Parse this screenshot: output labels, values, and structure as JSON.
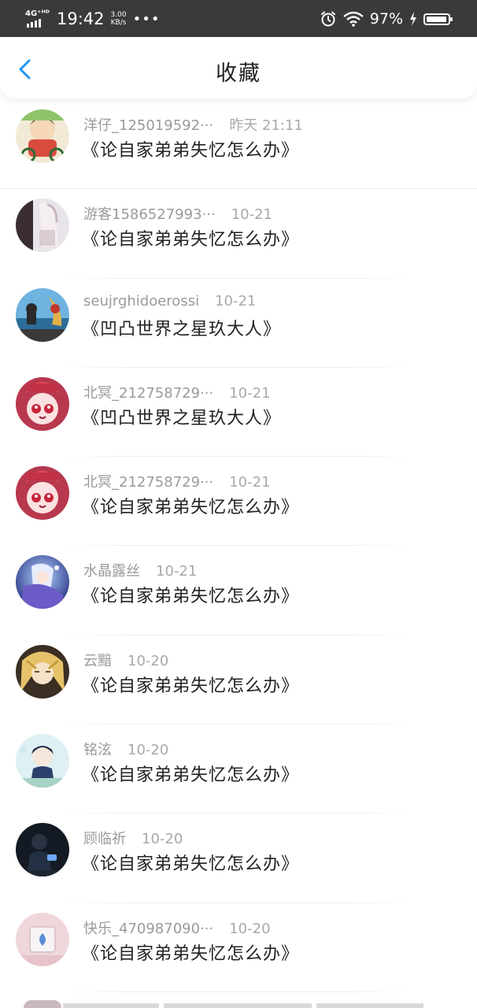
{
  "status_bar": {
    "network": "4G⁺ᴴᴰ",
    "time": "19:42",
    "speed_value": "3.00",
    "speed_unit": "KB/s",
    "more": "•••",
    "battery_percent": "97%",
    "battery_level": 0.97
  },
  "header": {
    "title": "收藏",
    "back_icon": "chevron-left-icon"
  },
  "colors": {
    "accent": "#2196F3",
    "status_bar_bg": "#3a3a3a"
  },
  "items": [
    {
      "user": "洋仔_125019592···",
      "time": "昨天 21:11",
      "book": "《论自家弟弟失忆怎么办》"
    },
    {
      "user": "游客1586527993···",
      "time": "10-21",
      "book": "《论自家弟弟失忆怎么办》"
    },
    {
      "user": "seujrghidoerossi",
      "time": "10-21",
      "book": "《凹凸世界之星玖大人》"
    },
    {
      "user": "北冥_212758729···",
      "time": "10-21",
      "book": "《凹凸世界之星玖大人》"
    },
    {
      "user": "北冥_212758729···",
      "time": "10-21",
      "book": "《论自家弟弟失忆怎么办》"
    },
    {
      "user": "水晶露丝",
      "time": "10-21",
      "book": "《论自家弟弟失忆怎么办》"
    },
    {
      "user": "云黯",
      "time": "10-20",
      "book": "《论自家弟弟失忆怎么办》"
    },
    {
      "user": "铭泫",
      "time": "10-20",
      "book": "《论自家弟弟失忆怎么办》"
    },
    {
      "user": "顾临祈",
      "time": "10-20",
      "book": "《论自家弟弟失忆怎么办》"
    },
    {
      "user": "快乐_470987090···",
      "time": "10-20",
      "book": "《论自家弟弟失忆怎么办》"
    }
  ]
}
